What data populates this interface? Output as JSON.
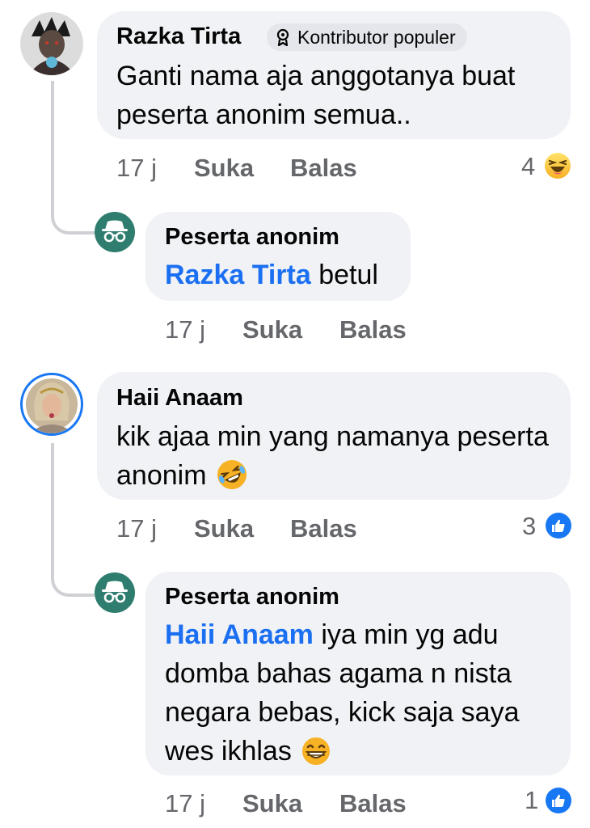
{
  "comments": [
    {
      "author": "Razka Tirta",
      "badge": "Kontributor populer",
      "text": "Ganti nama aja anggotanya buat peserta anonim semua..",
      "time": "17 j",
      "like_label": "Suka",
      "reply_label": "Balas",
      "reaction_count": "4",
      "reaction": "haha-icon",
      "replies": [
        {
          "author": "Peserta anonim",
          "mention": "Razka Tirta",
          "text": " betul",
          "time": "17 j",
          "like_label": "Suka",
          "reply_label": "Balas"
        }
      ]
    },
    {
      "author": "Haii Anaam",
      "text": "kik ajaa min yang namanya peserta anonim",
      "time": "17 j",
      "like_label": "Suka",
      "reply_label": "Balas",
      "reaction_count": "3",
      "reaction": "like-icon",
      "replies": [
        {
          "author": "Peserta anonim",
          "mention": "Haii Anaam",
          "text": " iya min yg adu domba bahas agama n nista negara bebas, kick saja saya wes ikhlas",
          "time": "17 j",
          "like_label": "Suka",
          "reply_label": "Balas",
          "reaction_count": "1",
          "reaction": "like-icon"
        }
      ]
    }
  ],
  "colors": {
    "bubble": "#f0f2f5",
    "mention": "#1b6ff2",
    "meta": "#65676b",
    "anon": "#2e7d6e",
    "like": "#1877f2"
  }
}
